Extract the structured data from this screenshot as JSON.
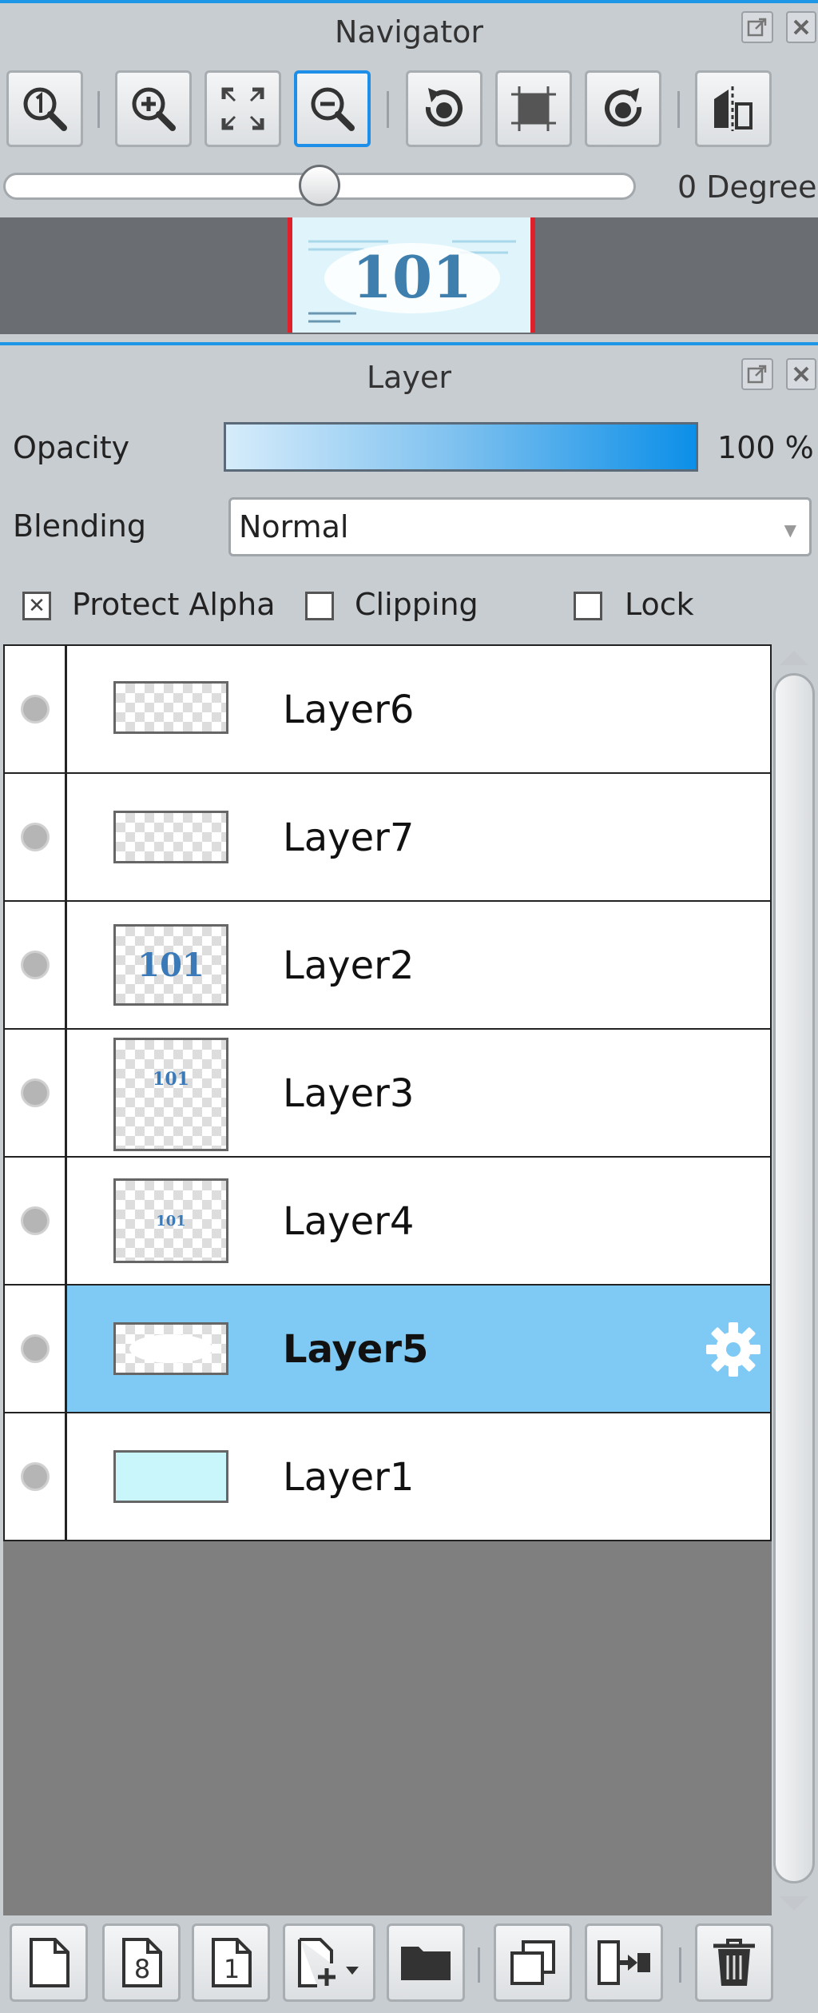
{
  "navigator": {
    "title": "Navigator",
    "degree_text": "0 Degree",
    "rotation_slider_value": 0.5,
    "thumbnail_text": "101",
    "toolbar": [
      {
        "name": "actual-size-button",
        "icon": "zoom-one-icon"
      },
      {
        "name": "zoom-in-button",
        "icon": "zoom-in-icon"
      },
      {
        "name": "fit-window-button",
        "icon": "fit-screen-icon"
      },
      {
        "name": "zoom-out-button",
        "icon": "zoom-out-icon"
      },
      {
        "name": "rotate-left-button",
        "icon": "rotate-left-icon"
      },
      {
        "name": "reset-rotation-button",
        "icon": "frame-icon"
      },
      {
        "name": "rotate-right-button",
        "icon": "rotate-right-icon"
      },
      {
        "name": "flip-horizontal-button",
        "icon": "flip-icon"
      }
    ]
  },
  "layer_panel": {
    "title": "Layer",
    "opacity_label": "Opacity",
    "opacity_value": "100 %",
    "blending_label": "Blending",
    "blending_value": "Normal",
    "protect_alpha_label": "Protect Alpha",
    "protect_alpha_mark": "✕",
    "clipping_label": "Clipping",
    "lock_label": "Lock",
    "layers": [
      {
        "name": "Layer6",
        "thumb_text": ""
      },
      {
        "name": "Layer7",
        "thumb_text": ""
      },
      {
        "name": "Layer2",
        "thumb_text": "101"
      },
      {
        "name": "Layer3",
        "thumb_text": "101"
      },
      {
        "name": "Layer4",
        "thumb_text": "101"
      },
      {
        "name": "Layer5",
        "thumb_text": ""
      },
      {
        "name": "Layer1",
        "thumb_text": ""
      }
    ],
    "selected_layer": "Layer5",
    "bottom_toolbar": [
      {
        "name": "new-layer-button",
        "icon": "new-page-icon"
      },
      {
        "name": "new-8bit-layer-button",
        "icon": "page-8-icon"
      },
      {
        "name": "new-1bit-layer-button",
        "icon": "page-1-icon"
      },
      {
        "name": "add-layer-menu-button",
        "icon": "add-page-dropdown-icon"
      },
      {
        "name": "new-folder-button",
        "icon": "folder-icon"
      },
      {
        "name": "duplicate-layer-button",
        "icon": "duplicate-icon"
      },
      {
        "name": "merge-down-button",
        "icon": "merge-icon"
      },
      {
        "name": "delete-layer-button",
        "icon": "trash-icon"
      }
    ],
    "new_8bit_label": "8",
    "new_1bit_label": "1"
  },
  "colors": {
    "accent": "#1e96e6",
    "selected_row": "#7fcaf4",
    "panel_bg": "#c8cdd2"
  }
}
